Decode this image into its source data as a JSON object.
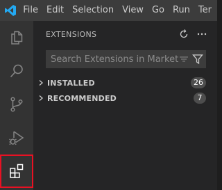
{
  "menu": {
    "items": [
      "File",
      "Edit",
      "Selection",
      "View",
      "Go",
      "Run",
      "Ter"
    ]
  },
  "activity_bar": {
    "items": [
      {
        "icon": "explorer-icon"
      },
      {
        "icon": "search-icon"
      },
      {
        "icon": "source-control-icon"
      },
      {
        "icon": "run-debug-icon"
      },
      {
        "icon": "extensions-icon",
        "active": true
      }
    ]
  },
  "sidebar": {
    "title": "EXTENSIONS",
    "search": {
      "placeholder": "Search Extensions in Market...",
      "value": ""
    },
    "sections": [
      {
        "label": "INSTALLED",
        "count": "26"
      },
      {
        "label": "RECOMMENDED",
        "count": "7"
      }
    ]
  },
  "colors": {
    "titlebar": "#3c3c3c",
    "activitybar": "#333333",
    "sidebar": "#252526",
    "badge": "#4d4d4d",
    "highlight": "#e81123",
    "vscode_blue": "#23a9f2"
  }
}
